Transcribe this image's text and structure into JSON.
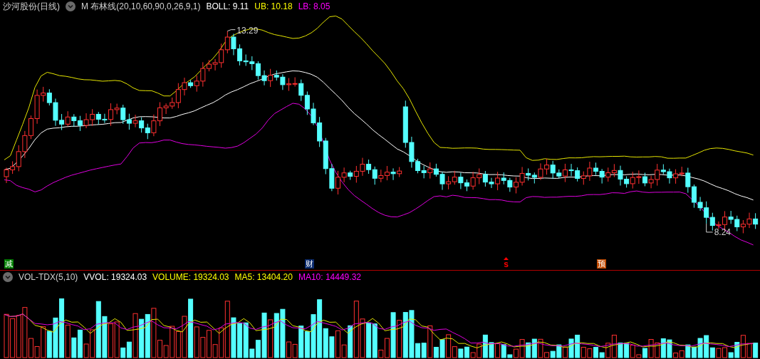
{
  "header": {
    "security": "沙河股份(日线)",
    "indicator": "M 布林线(20,10,60,90,0,26,9,1)",
    "values": [
      {
        "label": "BOLL: 9.11",
        "color": "#ffffff"
      },
      {
        "label": "UB: 10.18",
        "color": "#ffff00"
      },
      {
        "label": "LB: 8.05",
        "color": "#ff00ff"
      }
    ]
  },
  "price_chart": {
    "high_label": "13.29",
    "low_label": "8.24"
  },
  "event_markers": [
    {
      "label": "减",
      "kind": "box",
      "color": "#008000"
    },
    {
      "label": "财",
      "kind": "box",
      "color": "#0a2a6e"
    },
    {
      "label": "s",
      "kind": "arrow",
      "color": "#ff0000"
    },
    {
      "label": "预",
      "kind": "box",
      "color": "#c04a00"
    }
  ],
  "volume_header": {
    "indicator": "VOL-TDX(5,10)",
    "values": [
      {
        "label": "VVOL: 19324.03",
        "color": "#ffffff"
      },
      {
        "label": "VOLUME: 19324.03",
        "color": "#ffff00"
      },
      {
        "label": "MA5: 13404.20",
        "color": "#ffff00"
      },
      {
        "label": "MA10: 14449.32",
        "color": "#ff00ff"
      }
    ]
  }
}
